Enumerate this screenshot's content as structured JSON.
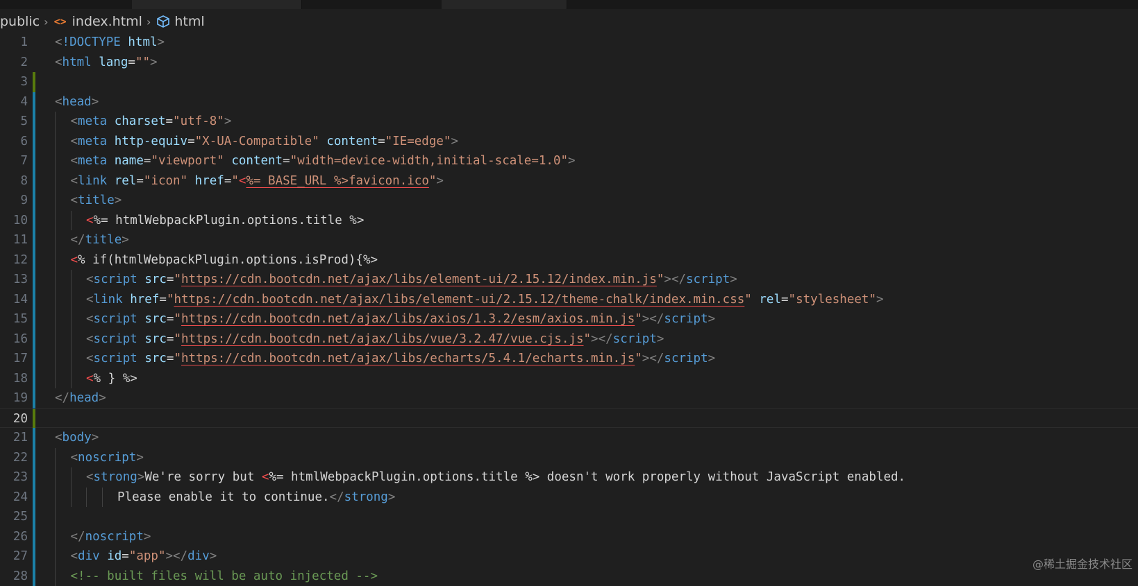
{
  "breadcrumb": {
    "folder": "public",
    "file": "index.html",
    "symbol": "html"
  },
  "current_line": 20,
  "watermark": "@稀土掘金技术社区",
  "colors": {
    "background": "#1f1f1f",
    "tag": "#569cd6",
    "attribute": "#9cdcfe",
    "string": "#ce9178",
    "ejs_delimiter": "#f14c4c",
    "gutter_added": "#587c0c",
    "gutter_modified": "#1b81a8"
  },
  "lines": [
    {
      "n": "1",
      "indent": 0,
      "gutter": "",
      "tokens": [
        [
          "punct",
          "<"
        ],
        [
          "tag",
          "!DOCTYPE "
        ],
        [
          "attr",
          "html"
        ],
        [
          "punct",
          ">"
        ]
      ]
    },
    {
      "n": "2",
      "indent": 0,
      "gutter": "",
      "tokens": [
        [
          "punct",
          "<"
        ],
        [
          "tag",
          "html "
        ],
        [
          "attr",
          "lang"
        ],
        [
          "text",
          "="
        ],
        [
          "str",
          "\"\""
        ],
        [
          "punct",
          ">"
        ]
      ]
    },
    {
      "n": "3",
      "indent": 0,
      "gutter": "added",
      "tokens": []
    },
    {
      "n": "4",
      "indent": 0,
      "gutter": "modified",
      "tokens": [
        [
          "punct",
          "<"
        ],
        [
          "tag",
          "head"
        ],
        [
          "punct",
          ">"
        ]
      ]
    },
    {
      "n": "5",
      "indent": 1,
      "gutter": "modified",
      "tokens": [
        [
          "punct",
          "<"
        ],
        [
          "tag",
          "meta "
        ],
        [
          "attr",
          "charset"
        ],
        [
          "text",
          "="
        ],
        [
          "str",
          "\"utf-8\""
        ],
        [
          "punct",
          ">"
        ]
      ]
    },
    {
      "n": "6",
      "indent": 1,
      "gutter": "modified",
      "tokens": [
        [
          "punct",
          "<"
        ],
        [
          "tag",
          "meta "
        ],
        [
          "attr",
          "http-equiv"
        ],
        [
          "text",
          "="
        ],
        [
          "str",
          "\"X-UA-Compatible\""
        ],
        [
          "text",
          " "
        ],
        [
          "attr",
          "content"
        ],
        [
          "text",
          "="
        ],
        [
          "str",
          "\"IE=edge\""
        ],
        [
          "punct",
          ">"
        ]
      ]
    },
    {
      "n": "7",
      "indent": 1,
      "gutter": "modified",
      "tokens": [
        [
          "punct",
          "<"
        ],
        [
          "tag",
          "meta "
        ],
        [
          "attr",
          "name"
        ],
        [
          "text",
          "="
        ],
        [
          "str",
          "\"viewport\""
        ],
        [
          "text",
          " "
        ],
        [
          "attr",
          "content"
        ],
        [
          "text",
          "="
        ],
        [
          "str",
          "\"width=device-width,initial-scale=1.0\""
        ],
        [
          "punct",
          ">"
        ]
      ]
    },
    {
      "n": "8",
      "indent": 1,
      "gutter": "modified",
      "tokens": [
        [
          "punct",
          "<"
        ],
        [
          "tag",
          "link "
        ],
        [
          "attr",
          "rel"
        ],
        [
          "text",
          "="
        ],
        [
          "str",
          "\"icon\""
        ],
        [
          "text",
          " "
        ],
        [
          "attr",
          "href"
        ],
        [
          "text",
          "="
        ],
        [
          "str",
          "\""
        ],
        [
          "ejs",
          "<"
        ],
        [
          "url",
          "%= BASE_URL %>favicon.ico"
        ],
        [
          "str",
          "\""
        ],
        [
          "punct",
          ">"
        ]
      ]
    },
    {
      "n": "9",
      "indent": 1,
      "gutter": "modified",
      "tokens": [
        [
          "punct",
          "<"
        ],
        [
          "tag",
          "title"
        ],
        [
          "punct",
          ">"
        ]
      ]
    },
    {
      "n": "10",
      "indent": 2,
      "gutter": "modified",
      "tokens": [
        [
          "ejs",
          "<"
        ],
        [
          "text",
          "%= htmlWebpackPlugin.options.title %>"
        ]
      ]
    },
    {
      "n": "11",
      "indent": 1,
      "gutter": "modified",
      "tokens": [
        [
          "punct",
          "</"
        ],
        [
          "tag",
          "title"
        ],
        [
          "punct",
          ">"
        ]
      ]
    },
    {
      "n": "12",
      "indent": 1,
      "gutter": "modified",
      "tokens": [
        [
          "ejs",
          "<"
        ],
        [
          "text",
          "% if(htmlWebpackPlugin.options.isProd){%>"
        ]
      ]
    },
    {
      "n": "13",
      "indent": 2,
      "gutter": "modified",
      "tokens": [
        [
          "punct",
          "<"
        ],
        [
          "tag",
          "script "
        ],
        [
          "attr",
          "src"
        ],
        [
          "text",
          "="
        ],
        [
          "str",
          "\""
        ],
        [
          "url",
          "https://cdn.bootcdn.net/ajax/libs/element-ui/2.15.12/index.min.js"
        ],
        [
          "str",
          "\""
        ],
        [
          "punct",
          "></"
        ],
        [
          "tag",
          "script"
        ],
        [
          "punct",
          ">"
        ]
      ]
    },
    {
      "n": "14",
      "indent": 2,
      "gutter": "modified",
      "tokens": [
        [
          "punct",
          "<"
        ],
        [
          "tag",
          "link "
        ],
        [
          "attr",
          "href"
        ],
        [
          "text",
          "="
        ],
        [
          "str",
          "\""
        ],
        [
          "url",
          "https://cdn.bootcdn.net/ajax/libs/element-ui/2.15.12/theme-chalk/index.min.css"
        ],
        [
          "str",
          "\""
        ],
        [
          "text",
          " "
        ],
        [
          "attr",
          "rel"
        ],
        [
          "text",
          "="
        ],
        [
          "str",
          "\"stylesheet\""
        ],
        [
          "punct",
          ">"
        ]
      ]
    },
    {
      "n": "15",
      "indent": 2,
      "gutter": "modified",
      "tokens": [
        [
          "punct",
          "<"
        ],
        [
          "tag",
          "script "
        ],
        [
          "attr",
          "src"
        ],
        [
          "text",
          "="
        ],
        [
          "str",
          "\""
        ],
        [
          "url",
          "https://cdn.bootcdn.net/ajax/libs/axios/1.3.2/esm/axios.min.js"
        ],
        [
          "str",
          "\""
        ],
        [
          "punct",
          "></"
        ],
        [
          "tag",
          "script"
        ],
        [
          "punct",
          ">"
        ]
      ]
    },
    {
      "n": "16",
      "indent": 2,
      "gutter": "modified",
      "tokens": [
        [
          "punct",
          "<"
        ],
        [
          "tag",
          "script "
        ],
        [
          "attr",
          "src"
        ],
        [
          "text",
          "="
        ],
        [
          "str",
          "\""
        ],
        [
          "url",
          "https://cdn.bootcdn.net/ajax/libs/vue/3.2.47/vue.cjs.js"
        ],
        [
          "str",
          "\""
        ],
        [
          "punct",
          "></"
        ],
        [
          "tag",
          "script"
        ],
        [
          "punct",
          ">"
        ]
      ]
    },
    {
      "n": "17",
      "indent": 2,
      "gutter": "modified",
      "tokens": [
        [
          "punct",
          "<"
        ],
        [
          "tag",
          "script "
        ],
        [
          "attr",
          "src"
        ],
        [
          "text",
          "="
        ],
        [
          "str",
          "\""
        ],
        [
          "url",
          "https://cdn.bootcdn.net/ajax/libs/echarts/5.4.1/echarts.min.js"
        ],
        [
          "str",
          "\""
        ],
        [
          "punct",
          "></"
        ],
        [
          "tag",
          "script"
        ],
        [
          "punct",
          ">"
        ]
      ]
    },
    {
      "n": "18",
      "indent": 2,
      "gutter": "modified",
      "tokens": [
        [
          "ejs",
          "<"
        ],
        [
          "text",
          "% } %>"
        ]
      ]
    },
    {
      "n": "19",
      "indent": 0,
      "gutter": "modified",
      "tokens": [
        [
          "punct",
          "</"
        ],
        [
          "tag",
          "head"
        ],
        [
          "punct",
          ">"
        ]
      ]
    },
    {
      "n": "20",
      "indent": 0,
      "gutter": "added",
      "tokens": []
    },
    {
      "n": "21",
      "indent": 0,
      "gutter": "modified",
      "tokens": [
        [
          "punct",
          "<"
        ],
        [
          "tag",
          "body"
        ],
        [
          "punct",
          ">"
        ]
      ]
    },
    {
      "n": "22",
      "indent": 1,
      "gutter": "modified",
      "tokens": [
        [
          "punct",
          "<"
        ],
        [
          "tag",
          "noscript"
        ],
        [
          "punct",
          ">"
        ]
      ]
    },
    {
      "n": "23",
      "indent": 2,
      "gutter": "modified",
      "tokens": [
        [
          "punct",
          "<"
        ],
        [
          "tag",
          "strong"
        ],
        [
          "punct",
          ">"
        ],
        [
          "text",
          "We're sorry but "
        ],
        [
          "ejs",
          "<"
        ],
        [
          "text",
          "%= htmlWebpackPlugin.options.title %> doesn't work properly without JavaScript enabled."
        ]
      ]
    },
    {
      "n": "24",
      "indent": 4,
      "gutter": "modified",
      "tokens": [
        [
          "text",
          "Please enable it to continue."
        ],
        [
          "punct",
          "</"
        ],
        [
          "tag",
          "strong"
        ],
        [
          "punct",
          ">"
        ]
      ]
    },
    {
      "n": "25",
      "indent": 1,
      "gutter": "modified",
      "tokens": []
    },
    {
      "n": "26",
      "indent": 1,
      "gutter": "modified",
      "tokens": [
        [
          "punct",
          "</"
        ],
        [
          "tag",
          "noscript"
        ],
        [
          "punct",
          ">"
        ]
      ]
    },
    {
      "n": "27",
      "indent": 1,
      "gutter": "modified",
      "tokens": [
        [
          "punct",
          "<"
        ],
        [
          "tag",
          "div "
        ],
        [
          "attr",
          "id"
        ],
        [
          "text",
          "="
        ],
        [
          "str",
          "\"app\""
        ],
        [
          "punct",
          "></"
        ],
        [
          "tag",
          "div"
        ],
        [
          "punct",
          ">"
        ]
      ]
    },
    {
      "n": "28",
      "indent": 1,
      "gutter": "modified",
      "tokens": [
        [
          "comment",
          "<!-- built files will be auto injected -->"
        ]
      ]
    }
  ]
}
